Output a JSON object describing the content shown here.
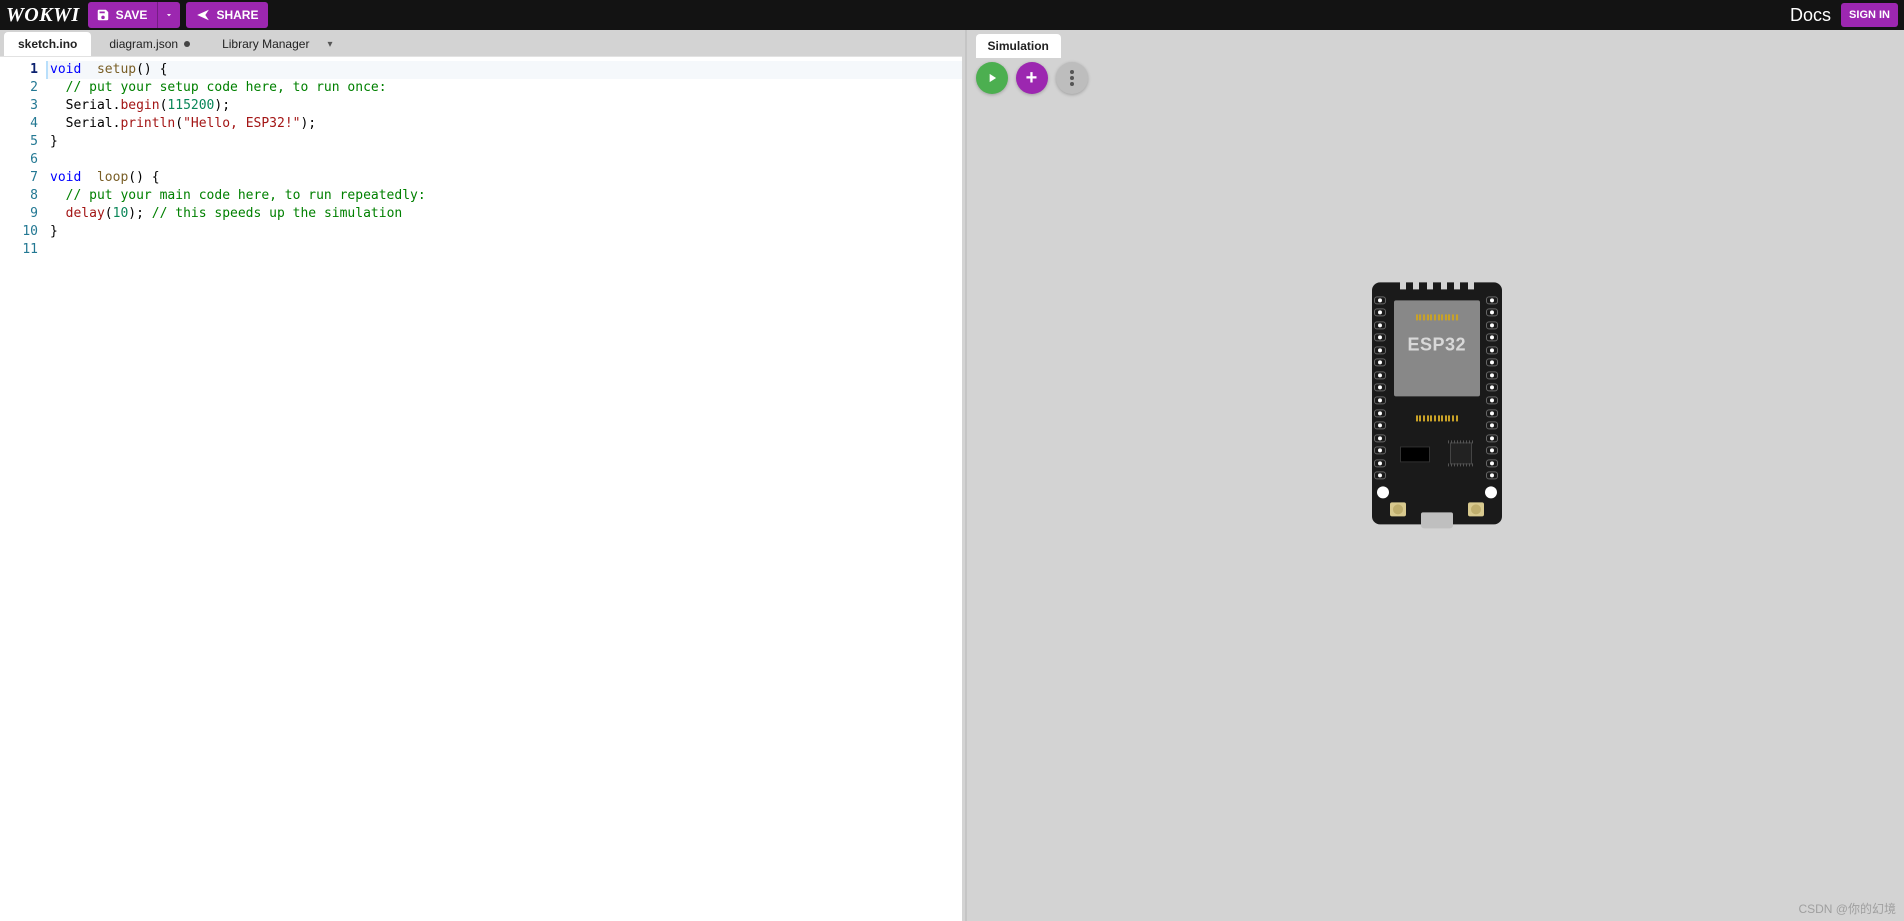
{
  "brand": "WOKWI",
  "topbar": {
    "save": "SAVE",
    "share": "SHARE",
    "docs": "Docs",
    "signin": "SIGN IN"
  },
  "editor_tabs": [
    {
      "label": "sketch.ino",
      "active": true,
      "dirty": false
    },
    {
      "label": "diagram.json",
      "active": false,
      "dirty": true
    },
    {
      "label": "Library Manager",
      "active": false,
      "dirty": false,
      "dropdown": true
    }
  ],
  "current_line": 1,
  "code_lines": [
    {
      "n": 1,
      "tokens": [
        [
          "kw",
          "void"
        ],
        [
          "",
          "  "
        ],
        [
          "fn",
          "setup"
        ],
        [
          "",
          "() {"
        ]
      ]
    },
    {
      "n": 2,
      "tokens": [
        [
          "",
          "  "
        ],
        [
          "cmt",
          "// put your setup code here, to run once:"
        ]
      ]
    },
    {
      "n": 3,
      "tokens": [
        [
          "",
          "  Serial."
        ],
        [
          "call",
          "begin"
        ],
        [
          "",
          "("
        ],
        [
          "num",
          "115200"
        ],
        [
          "",
          ");"
        ]
      ]
    },
    {
      "n": 4,
      "tokens": [
        [
          "",
          "  Serial."
        ],
        [
          "call",
          "println"
        ],
        [
          "",
          "("
        ],
        [
          "str",
          "\"Hello, ESP32!\""
        ],
        [
          "",
          ");"
        ]
      ]
    },
    {
      "n": 5,
      "tokens": [
        [
          "",
          "}"
        ]
      ]
    },
    {
      "n": 6,
      "tokens": [
        [
          "",
          ""
        ]
      ]
    },
    {
      "n": 7,
      "tokens": [
        [
          "kw",
          "void"
        ],
        [
          "",
          "  "
        ],
        [
          "fn",
          "loop"
        ],
        [
          "",
          "() {"
        ]
      ]
    },
    {
      "n": 8,
      "tokens": [
        [
          "",
          "  "
        ],
        [
          "cmt",
          "// put your main code here, to run repeatedly:"
        ]
      ]
    },
    {
      "n": 9,
      "tokens": [
        [
          "",
          "  "
        ],
        [
          "call",
          "delay"
        ],
        [
          "",
          "("
        ],
        [
          "num",
          "10"
        ],
        [
          "",
          "); "
        ],
        [
          "cmt",
          "// this speeds up the simulation"
        ]
      ]
    },
    {
      "n": 10,
      "tokens": [
        [
          "",
          "}"
        ]
      ]
    },
    {
      "n": 11,
      "tokens": [
        [
          "",
          ""
        ]
      ]
    }
  ],
  "sim_tab": "Simulation",
  "board_label": "ESP32",
  "watermark": "CSDN @你的幻境"
}
